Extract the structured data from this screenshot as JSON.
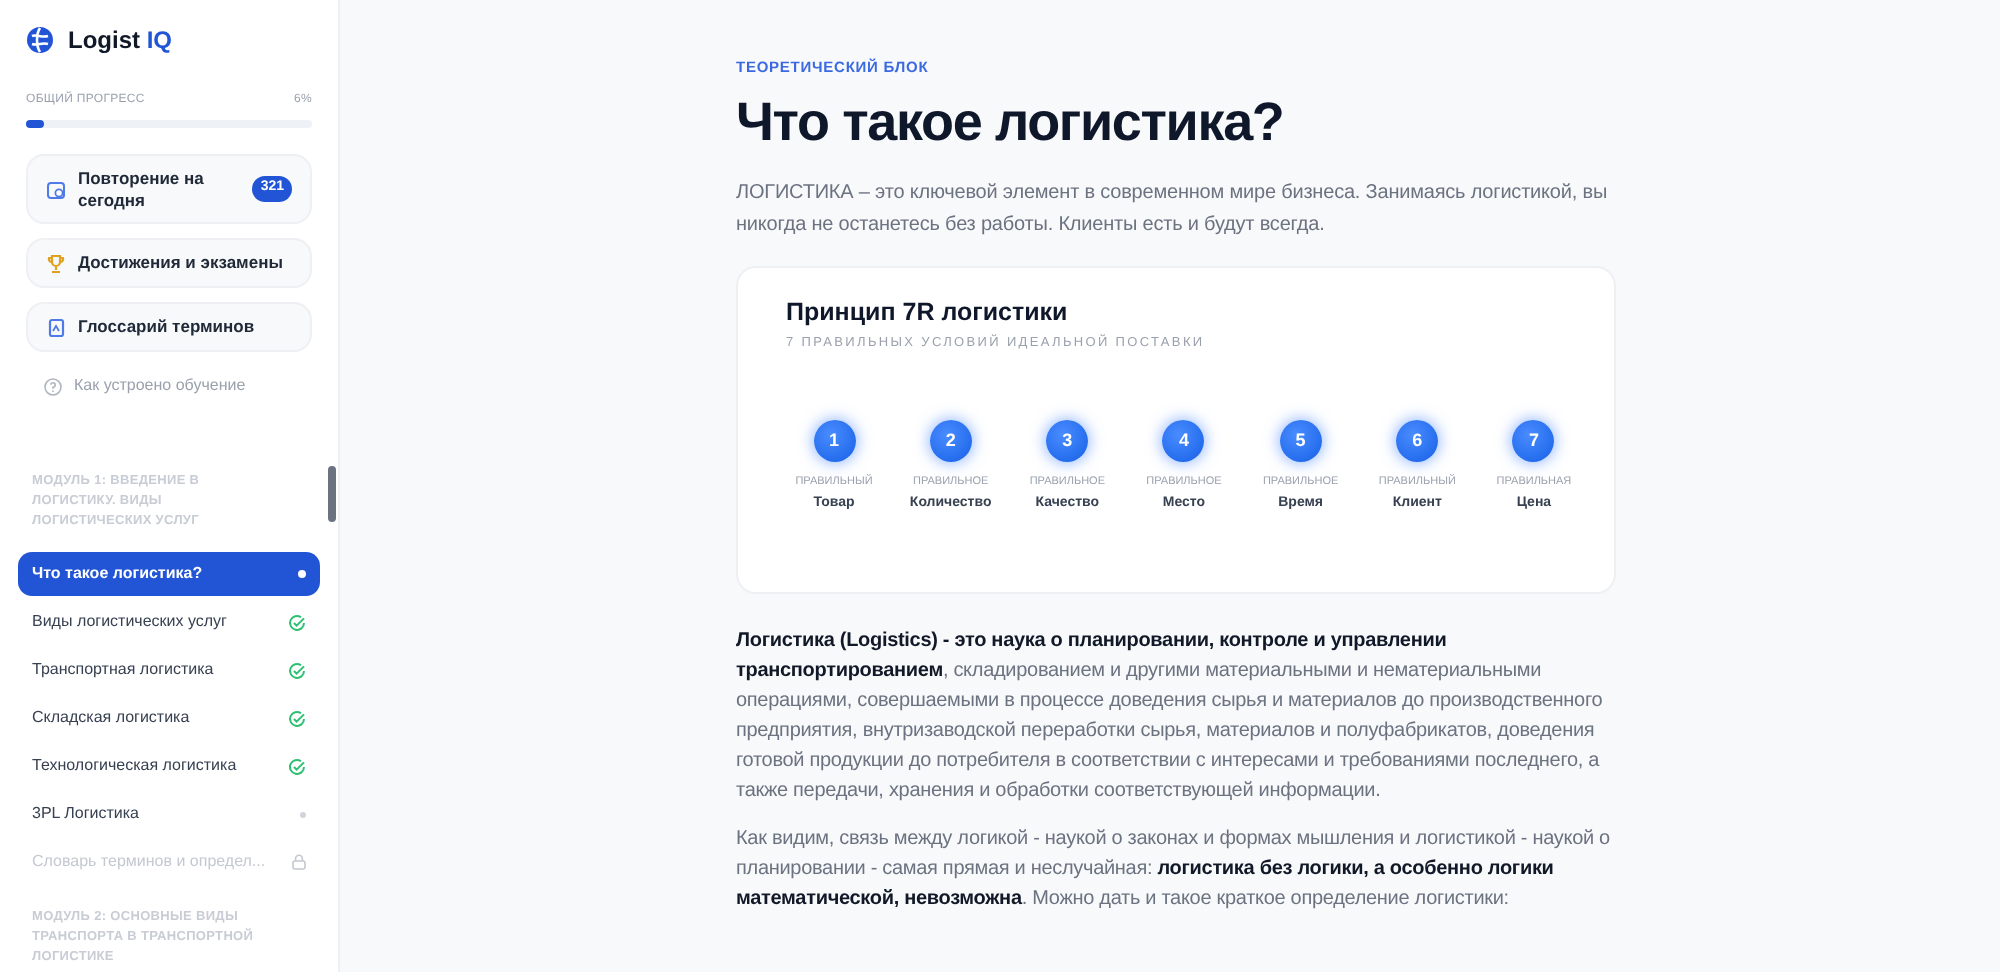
{
  "brand": {
    "name": "Logist",
    "accent": "IQ"
  },
  "progress": {
    "label": "ОБЩИЙ ПРОГРЕСС",
    "reading": "6%",
    "level": 0.06
  },
  "nav_cards": [
    {
      "kind": "review",
      "label": "Повторение на сегодня",
      "badge": "321"
    },
    {
      "kind": "trophy",
      "label": "Достижения и экзамены"
    },
    {
      "kind": "glossary",
      "label": "Глоссарий терминов"
    }
  ],
  "help_link": "Как устроено обучение",
  "modules": [
    {
      "title": "МОДУЛЬ 1: ВВЕДЕНИЕ В ЛОГИСТИКУ. ВИДЫ ЛОГИСТИЧЕСКИХ УСЛУГ",
      "lessons": [
        {
          "label": "Что такое логистика?",
          "selected": true,
          "kind": "current"
        },
        {
          "label": "Виды логистических услуг",
          "selected": false,
          "kind": "done"
        },
        {
          "label": "Транспортная логистика",
          "selected": false,
          "kind": "done"
        },
        {
          "label": "Складская логистика",
          "selected": false,
          "kind": "done"
        },
        {
          "label": "Технологическая логистика",
          "selected": false,
          "kind": "done"
        },
        {
          "label": "3PL Логистика",
          "selected": false,
          "kind": "open"
        },
        {
          "label": "Словарь терминов и определ...",
          "selected": false,
          "kind": "locked"
        }
      ]
    },
    {
      "title": "МОДУЛЬ 2: ОСНОВНЫЕ ВИДЫ ТРАНСПОРТА В ТРАНСПОРТНОЙ ЛОГИСТИКЕ"
    }
  ],
  "section_label": "ТЕОРЕТИЧЕСКИЙ БЛОК",
  "title": "Что такое логистика?",
  "intro": "ЛОГИСТИКА – это ключевой элемент в современном мире бизнеса. Занимаясь логистикой, вы никогда не останетесь без работы. Клиенты есть и будут всегда.",
  "principle": {
    "title": "Принцип 7R логистики",
    "subtitle": "7 ПРАВИЛЬНЫХ УСЛОВИЙ ИДЕАЛЬНОЙ ПОСТАВКИ",
    "steps": [
      {
        "number": "1",
        "caption": "ПРАВИЛЬНЫЙ",
        "label": "Товар"
      },
      {
        "number": "2",
        "caption": "ПРАВИЛЬНОЕ",
        "label": "Количество"
      },
      {
        "number": "3",
        "caption": "ПРАВИЛЬНОЕ",
        "label": "Качество"
      },
      {
        "number": "4",
        "caption": "ПРАВИЛЬНОЕ",
        "label": "Место"
      },
      {
        "number": "5",
        "caption": "ПРАВИЛЬНОЕ",
        "label": "Время"
      },
      {
        "number": "6",
        "caption": "ПРАВИЛЬНЫЙ",
        "label": "Клиент"
      },
      {
        "number": "7",
        "caption": "ПРАВИЛЬНАЯ",
        "label": "Цена"
      }
    ]
  },
  "paragraphs": [
    "**Логистика (Logistics) - это наука о планировании, контроле и управлении транспортированием**, складированием и другими материальными и нематериальными операциями, совершаемыми в процессе доведения сырья и материалов до производственного предприятия, внутризаводской переработки сырья, материалов и полуфабрикатов, доведения готовой продукции до потребителя в соответствии с интересами и требованиями последнего, а также передачи, хранения и обработки соответствующей информации.",
    "Как видим, связь между логикой - наукой о законах и формах мышления и логистикой - наукой о планировании - самая прямая и неслучайная: **логистика без логики, а особенно логики математической, невозможна**. Можно дать и такое краткое определение логистики:"
  ]
}
